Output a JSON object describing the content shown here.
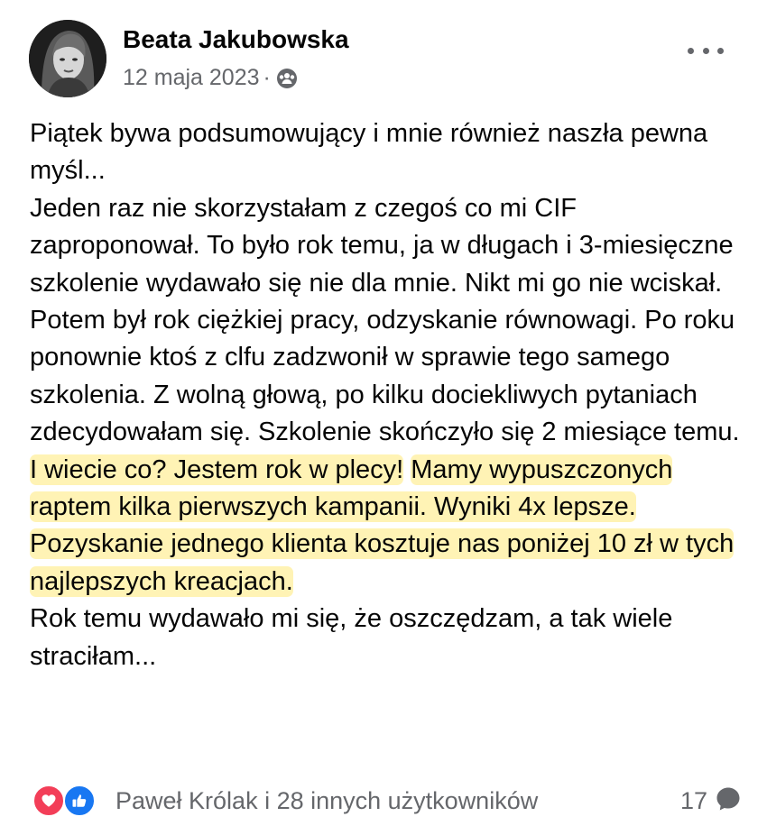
{
  "post": {
    "author": "Beata Jakubowska",
    "date": "12 maja 2023",
    "date_separator": "·",
    "privacy_icon": "group-icon",
    "more_icon": "more-horizontal-icon",
    "paragraphs": [
      "Piątek bywa podsumowujący i mnie również naszła pewna myśl...",
      "Jeden raz nie skorzystałam z czegoś co mi CIF zaproponował. To było rok temu, ja w długach i 3-miesięczne szkolenie wydawało się nie dla mnie. Nikt mi go nie wciskał.",
      "Potem był rok ciężkiej pracy, odzyskanie równowagi. Po roku ponownie ktoś z clfu zadzwonił w sprawie tego samego szkolenia. Z wolną głową, po kilku dociekliwych pytaniach zdecydowałam się. Szkolenie skończyło się 2 miesiące temu. "
    ],
    "highlight_1": "I wiecie co? Jestem rok w plecy!",
    "highlight_2": "Mamy wypuszczonych raptem kilka pierwszych kampanii. Wyniki 4x lepsze. Pozyskanie jednego klienta kosztuje nas poniżej 10 zł w tych najlepszych kreacjach.",
    "closing": " Rok temu wydawało mi się, że oszczędzam, a tak wiele straciłam..."
  },
  "footer": {
    "reaction_icons": [
      "love-icon",
      "like-icon"
    ],
    "reactions_text": "Paweł Królak i 28 innych użytkowników",
    "comment_count": "17",
    "comment_icon": "comment-bubble-icon"
  },
  "colors": {
    "highlight": "#fff3b5",
    "secondary_text": "#65676b",
    "love": "#f33e58",
    "like": "#1877f2"
  }
}
